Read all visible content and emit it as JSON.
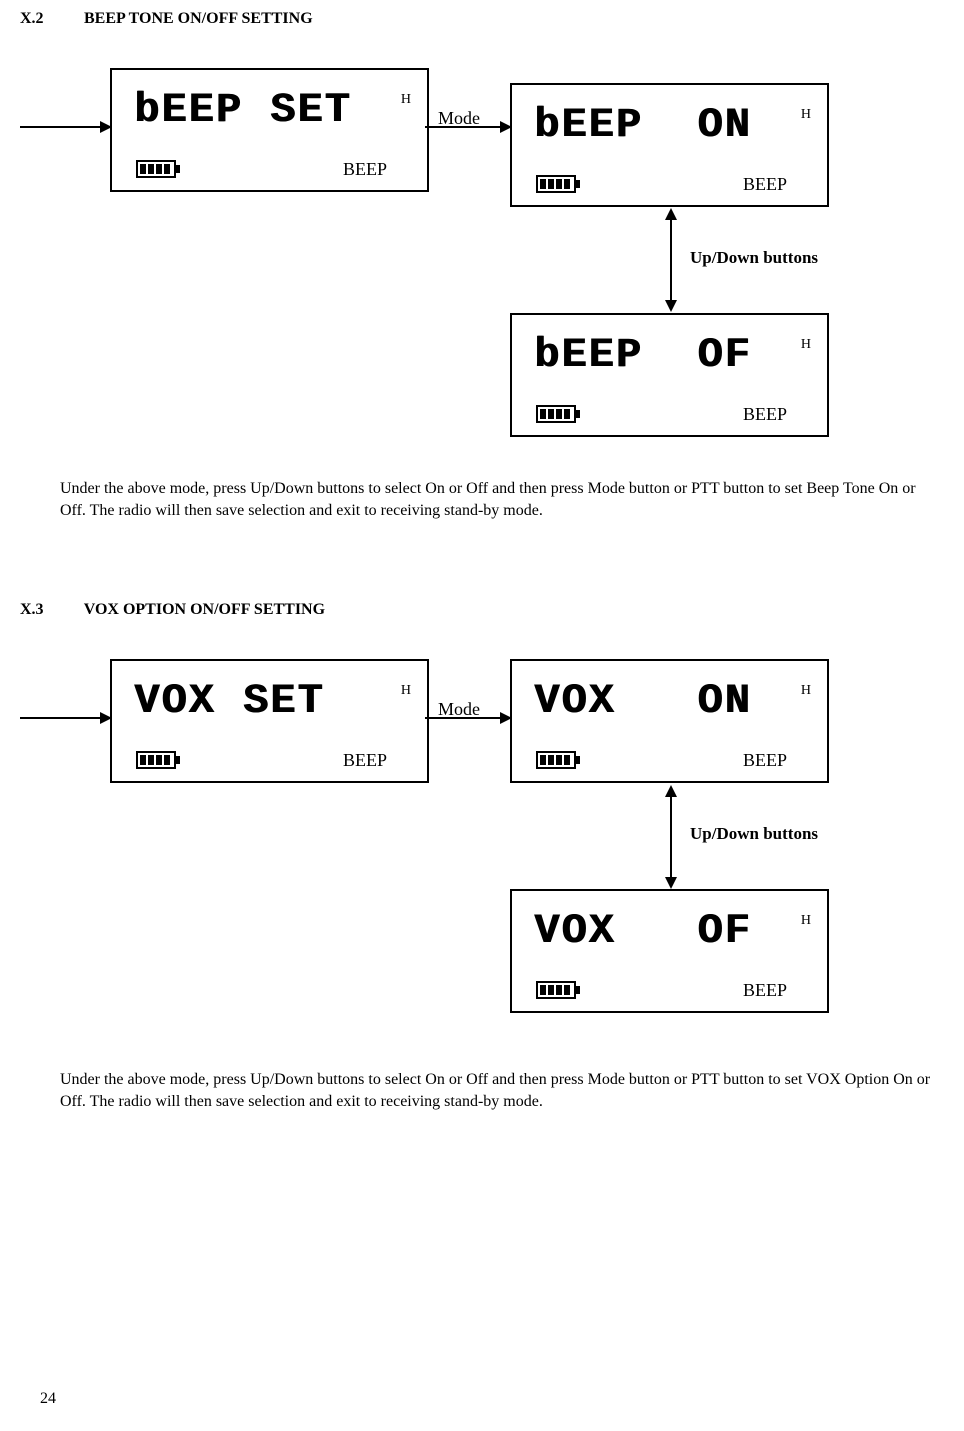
{
  "section1": {
    "num": "X.2",
    "title": "BEEP TONE ON/OFF SETTING",
    "lcd_set": {
      "main": "bEEP SET",
      "h": "H",
      "beep": "BEEP"
    },
    "lcd_on": {
      "main": "bEEP  ON",
      "h": "H",
      "beep": "BEEP"
    },
    "lcd_off": {
      "main": "bEEP  OF",
      "h": "H",
      "beep": "BEEP"
    },
    "mode_label": "Mode",
    "updown_label": "Up/Down buttons",
    "body": "Under the above mode, press Up/Down buttons to select On or Off and then press Mode button or PTT button to set Beep Tone  On or Off. The radio will then save selection and exit to receiving stand-by mode."
  },
  "section2": {
    "num": "X.3",
    "title": "VOX OPTION ON/OFF SETTING",
    "lcd_set": {
      "main": "VOX SET",
      "h": "H",
      "beep": "BEEP"
    },
    "lcd_on": {
      "main": "VOX   ON",
      "h": "H",
      "beep": "BEEP"
    },
    "lcd_off": {
      "main": "VOX   OF",
      "h": "H",
      "beep": "BEEP"
    },
    "mode_label": "Mode",
    "updown_label": "Up/Down buttons",
    "body": "Under the above mode, press Up/Down buttons to select On or Off and then press Mode button or PTT button to set VOX Option On or Off. The radio will then save selection and exit to receiving stand-by mode."
  },
  "page_number": "24"
}
